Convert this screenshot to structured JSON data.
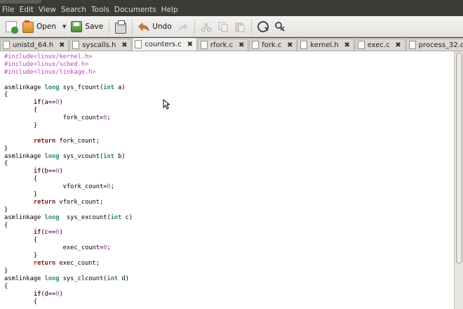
{
  "menu": [
    "File",
    "Edit",
    "View",
    "Search",
    "Tools",
    "Documents",
    "Help"
  ],
  "toolbar": {
    "open_label": "Open",
    "save_label": "Save",
    "undo_label": "Undo"
  },
  "tabs": [
    {
      "name": "unistd_64.h",
      "active": false
    },
    {
      "name": "syscalls.h",
      "active": false
    },
    {
      "name": "counters.c",
      "active": true
    },
    {
      "name": "rfork.c",
      "active": false
    },
    {
      "name": "fork.c",
      "active": false
    },
    {
      "name": "kernel.h",
      "active": false
    },
    {
      "name": "exec.c",
      "active": false
    },
    {
      "name": "process_32.c",
      "active": false
    }
  ],
  "code_lines": [
    "#include<linux/kernel.h>",
    "#include<linux/sched.h>",
    "#include<linux/linkage.h>",
    "",
    "asmlinkage long sys_fcount(int a)",
    "{",
    "        if(a==0)",
    "        {",
    "                fork_count=0;",
    "        }",
    "",
    "        return fork_count;",
    "}",
    "asmlinkage long sys_vcount(int b)",
    "{",
    "        if(b==0)",
    "        {",
    "                vfork_count=0;",
    "        }",
    "        return vfork_count;",
    "}",
    "asmlinkage long  sys_excount(int c)",
    "{",
    "        if(c==0)",
    "        {",
    "                exec_count=0;",
    "        }",
    "        return exec_count;",
    "}",
    "asmlinkage long sys_clcount(int d)",
    "{",
    "        if(d==0)",
    "        {"
  ]
}
